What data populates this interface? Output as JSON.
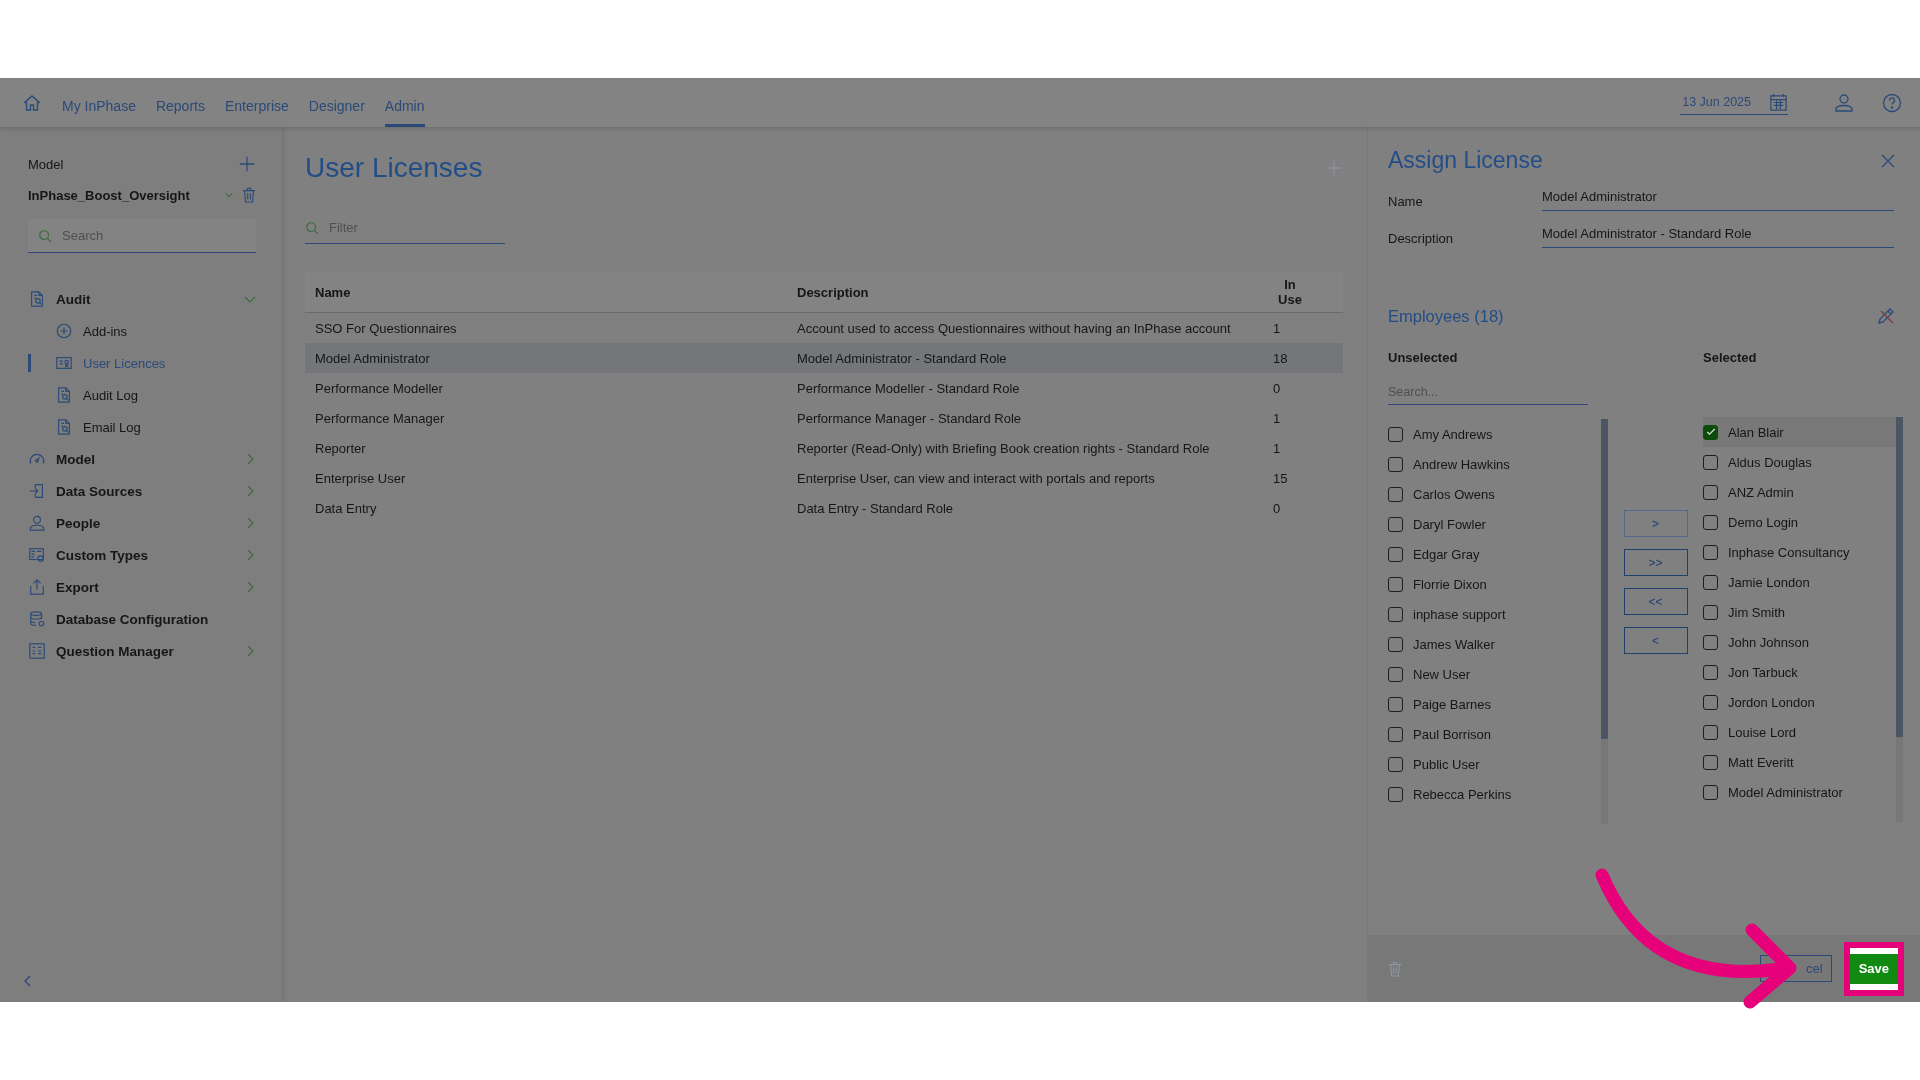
{
  "nav": {
    "tabs": [
      {
        "label": "My InPhase",
        "selected": false
      },
      {
        "label": "Reports",
        "selected": false
      },
      {
        "label": "Enterprise",
        "selected": false
      },
      {
        "label": "Designer",
        "selected": false
      },
      {
        "label": "Admin",
        "selected": true
      }
    ],
    "date": "13 Jun 2025"
  },
  "sidebar": {
    "model_label": "Model",
    "model_name": "InPhase_Boost_Oversight",
    "search_placeholder": "Search",
    "items": [
      {
        "label": "Audit",
        "expanded": true,
        "children": [
          {
            "label": "Add-ins",
            "selected": false
          },
          {
            "label": "User Licences",
            "selected": true
          },
          {
            "label": "Audit Log",
            "selected": false
          },
          {
            "label": "Email Log",
            "selected": false
          }
        ]
      },
      {
        "label": "Model",
        "expanded": false
      },
      {
        "label": "Data Sources",
        "expanded": false
      },
      {
        "label": "People",
        "expanded": false
      },
      {
        "label": "Custom Types",
        "expanded": false
      },
      {
        "label": "Export",
        "expanded": false
      },
      {
        "label": "Database Configuration"
      },
      {
        "label": "Question Manager",
        "expanded": false
      }
    ]
  },
  "main": {
    "title": "User Licenses",
    "filter_placeholder": "Filter",
    "table": {
      "columns": [
        "Name",
        "Description",
        "In Use"
      ],
      "rows": [
        {
          "cells": [
            "SSO For Questionnaires",
            "Account used to access Questionnaires without having an InPhase account",
            "1"
          ],
          "selected": false
        },
        {
          "cells": [
            "Model Administrator",
            "Model Administrator - Standard Role",
            "18"
          ],
          "selected": true
        },
        {
          "cells": [
            "Performance Modeller",
            "Performance Modeller - Standard Role",
            "0"
          ],
          "selected": false
        },
        {
          "cells": [
            "Performance Manager",
            "Performance Manager - Standard Role",
            "1"
          ],
          "selected": false
        },
        {
          "cells": [
            "Reporter",
            "Reporter (Read-Only) with Briefing Book creation rights - Standard Role",
            "1"
          ],
          "selected": false
        },
        {
          "cells": [
            "Enterprise User",
            "Enterprise User, can view and interact with portals and reports",
            "15"
          ],
          "selected": false
        },
        {
          "cells": [
            "Data Entry",
            "Data Entry - Standard Role",
            "0"
          ],
          "selected": false
        }
      ]
    }
  },
  "panel": {
    "title": "Assign License",
    "fields": [
      {
        "label": "Name",
        "value": "Model Administrator"
      },
      {
        "label": "Description",
        "value": "Model Administrator - Standard Role"
      }
    ],
    "employees_title": "Employees (18)",
    "unselected_label": "Unselected",
    "selected_label": "Selected",
    "search_placeholder": "Search...",
    "unselected": [
      {
        "name": "Amy Andrews",
        "checked": false
      },
      {
        "name": "Andrew Hawkins",
        "checked": false
      },
      {
        "name": "Carlos Owens",
        "checked": false
      },
      {
        "name": "Daryl Fowler",
        "checked": false
      },
      {
        "name": "Edgar Gray",
        "checked": false
      },
      {
        "name": "Florrie Dixon",
        "checked": false
      },
      {
        "name": "inphase support",
        "checked": false
      },
      {
        "name": "James Walker",
        "checked": false
      },
      {
        "name": "New User",
        "checked": false
      },
      {
        "name": "Paige Barnes",
        "checked": false
      },
      {
        "name": "Paul Borrison",
        "checked": false
      },
      {
        "name": "Public User",
        "checked": false
      },
      {
        "name": "Rebecca Perkins",
        "checked": false
      }
    ],
    "selected": [
      {
        "name": "Alan Blair",
        "checked": true
      },
      {
        "name": "Aldus Douglas",
        "checked": false
      },
      {
        "name": "ANZ Admin",
        "checked": false
      },
      {
        "name": "Demo Login",
        "checked": false
      },
      {
        "name": "Inphase Consultancy",
        "checked": false
      },
      {
        "name": "Jamie London",
        "checked": false
      },
      {
        "name": "Jim Smith",
        "checked": false
      },
      {
        "name": "John Johnson",
        "checked": false
      },
      {
        "name": "Jon Tarbuck",
        "checked": false
      },
      {
        "name": "Jordon London",
        "checked": false
      },
      {
        "name": "Louise Lord",
        "checked": false
      },
      {
        "name": "Matt Everitt",
        "checked": false
      },
      {
        "name": "Model Administrator",
        "checked": false
      }
    ],
    "transfer_buttons": [
      {
        "label": ">",
        "disabled": true
      },
      {
        "label": ">>",
        "disabled": false
      },
      {
        "label": "<<",
        "disabled": false
      },
      {
        "label": "<",
        "disabled": false
      }
    ],
    "cancel_label": "cel",
    "save_label": "Save"
  }
}
